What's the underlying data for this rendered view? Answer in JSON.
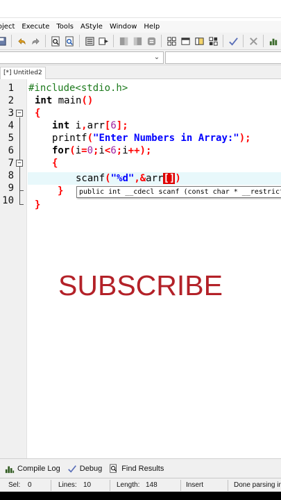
{
  "menu": [
    "roject",
    "Execute",
    "Tools",
    "AStyle",
    "Window",
    "Help"
  ],
  "tab": {
    "label": "[*] Untitled2"
  },
  "editor": {
    "line_numbers": [
      "1",
      "2",
      "3",
      "4",
      "5",
      "6",
      "7",
      "8",
      "9",
      "10"
    ],
    "lines": {
      "l1": "#include<stdio.h>",
      "l2_kw": "int",
      "l2_rest": " main",
      "l2_sym": "()",
      "l3": "{",
      "l4_kw": "int",
      "l4_a": " i",
      "l4_b": ",",
      "l4_c": "arr",
      "l4_d": "[",
      "l4_e": "6",
      "l4_f": "];",
      "l5_a": "printf",
      "l5_b": "(",
      "l5_c": "\"Enter Numbers in Array:\"",
      "l5_d": ");",
      "l6_kw": "for",
      "l6_a": "(",
      "l6_b": "i",
      "l6_c": "=",
      "l6_d": "0",
      "l6_e": ";",
      "l6_f": "i",
      "l6_g": "<",
      "l6_h": "6",
      "l6_i": ";",
      "l6_j": "i",
      "l6_k": "++);",
      "l7": "{",
      "l8_a": "scanf",
      "l8_b": "(",
      "l8_c": "\"%d\"",
      "l8_d": ",&",
      "l8_e": "arr",
      "l8_f": "[]",
      "l8_g": ")",
      "l9": "}",
      "l10": "}"
    },
    "tooltip": "public int __cdecl scanf (const char * __restrict__ _Format, ...)"
  },
  "overlay": {
    "text": "SUBSCRIBE"
  },
  "bottom_tabs": [
    "Compile Log",
    "Debug",
    "Find Results"
  ],
  "status": {
    "sel_label": "Sel:",
    "sel_value": "0",
    "lines_label": "Lines:",
    "lines_value": "10",
    "length_label": "Length:",
    "length_value": "148",
    "mode": "Insert",
    "message": "Done parsing in"
  },
  "colors": {
    "subscribe": "#b32128",
    "keyword": "#000000",
    "string": "#0000ff",
    "preprocessor": "#1d7a1d",
    "symbol": "#ff0000",
    "number": "#a020a0",
    "current_line": "#e8f8fb"
  },
  "icons": {
    "toolbar": [
      "undo-icon",
      "redo-icon",
      "find-icon",
      "replace-icon",
      "compile-icon",
      "run-icon",
      "indent-icon",
      "unindent-icon",
      "bookmark-icon",
      "grid-icon",
      "window-icon",
      "layout-icon",
      "tile-icon",
      "check-icon",
      "cross-icon",
      "chart-icon"
    ],
    "bottom": [
      "chart-icon",
      "check-icon",
      "search-icon"
    ]
  }
}
